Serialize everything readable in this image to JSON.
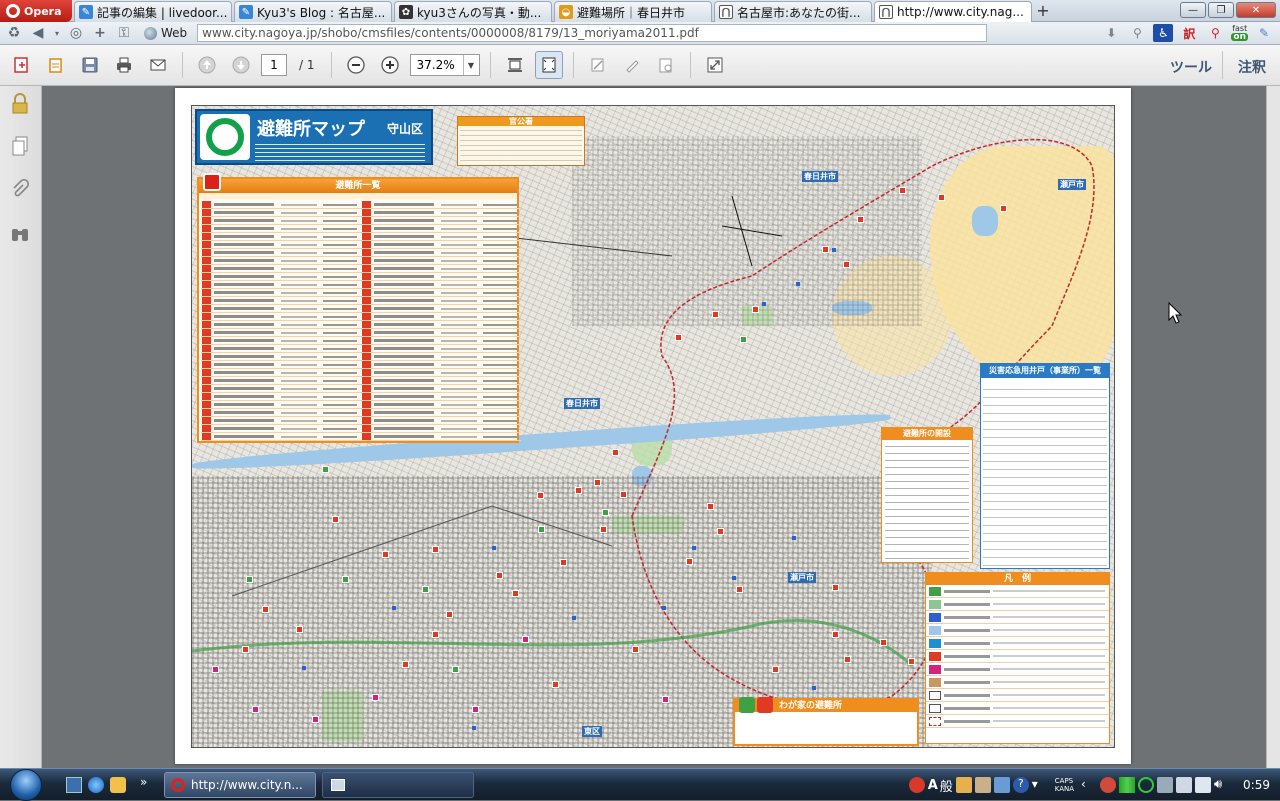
{
  "browser": {
    "menu_label": "Opera",
    "tabs": [
      {
        "label": "記事の編集 | livedoor...",
        "icon": "blog-edit-icon",
        "color": "#3a86d6"
      },
      {
        "label": "Kyu3's Blog : 名古屋...",
        "icon": "blog-icon",
        "color": "#3a86d6"
      },
      {
        "label": "kyu3さんの写真・動...",
        "icon": "photo-icon",
        "color": "#333333"
      },
      {
        "label": "避難場所｜春日井市",
        "icon": "city-kasugai-icon",
        "color": "#e29a1a"
      },
      {
        "label": "名古屋市:あなたの街...",
        "icon": "city-nagoya-icon",
        "color": "#555555"
      },
      {
        "label": "http://www.city.nag...",
        "icon": "city-nagoya-icon",
        "color": "#555555"
      }
    ],
    "active_tab": 5,
    "new_tab_label": "+",
    "address": {
      "search_engine": "Web",
      "url": "www.city.nagoya.jp/shobo/cmsfiles/contents/0000008/8179/13_moriyama2011.pdf"
    },
    "window_controls": {
      "minimize": "—",
      "maximize": "❐",
      "close": "✕"
    },
    "right_icons": [
      "download-icon",
      "link-icon",
      "accessibility-icon",
      "translate-icon",
      "search-red-icon",
      "fast-on-icon",
      "pin-icon"
    ],
    "translate_label": "訳",
    "fast_on": {
      "top": "fast",
      "bottom": "on"
    }
  },
  "pdf_toolbar": {
    "page_current": "1",
    "page_total": "/ 1",
    "zoom": "37.2%",
    "tools_label": "ツール",
    "comments_label": "注釈"
  },
  "map": {
    "title": "避難所マップ",
    "ward": "守山区",
    "gov_header": "官公署",
    "list_header": "避難所一覧",
    "wells_header": "災害応急用井戸（事業所）一覧",
    "opening_header": "避難所の開設",
    "legend_header": "凡　例",
    "my_shelter_header": "わが家の避難所",
    "labels": {
      "kasugai": "春日井市",
      "seto": "瀬戸市",
      "higashi": "東区"
    },
    "colors": {
      "shelter_red": "#e23a22",
      "wide_area_green": "#3fa046",
      "water_blue": "#2d5fd0",
      "hill_yellow": "#fae2a0",
      "boundary": "#c0282d"
    }
  },
  "taskbar": {
    "opera_button": "http://www.city.n...",
    "ime_a": "A",
    "ime_mode": "般",
    "caps": "CAPS",
    "kana": "KANA",
    "clock": "0:59"
  }
}
